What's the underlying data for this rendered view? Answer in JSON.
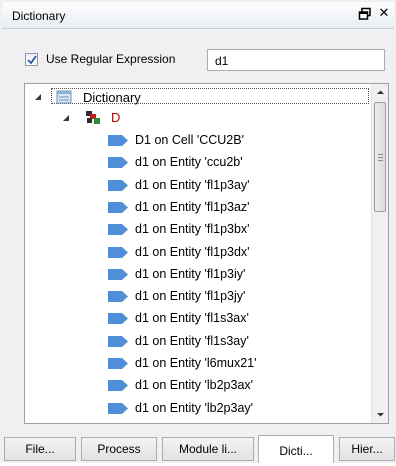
{
  "panel": {
    "title": "Dictionary"
  },
  "regex": {
    "label": "Use Regular Expression",
    "checked": true,
    "value": "d1"
  },
  "tree": {
    "root_label": "Dictionary",
    "group_label": "D",
    "items": [
      "D1 on Cell 'CCU2B'",
      "d1 on Entity 'ccu2b'",
      "d1 on Entity 'fl1p3ay'",
      "d1 on Entity 'fl1p3az'",
      "d1 on Entity 'fl1p3bx'",
      "d1 on Entity 'fl1p3dx'",
      "d1 on Entity 'fl1p3iy'",
      "d1 on Entity 'fl1p3jy'",
      "d1 on Entity 'fl1s3ax'",
      "d1 on Entity 'fl1s3ay'",
      "d1 on Entity 'l6mux21'",
      "d1 on Entity 'lb2p3ax'",
      "d1 on Entity 'lb2p3ay'"
    ]
  },
  "tabs": [
    "File...",
    "Process",
    "Module li...",
    "Dicti...",
    "Hier..."
  ],
  "active_tab": 3,
  "icons": {
    "float": "float-window-icon",
    "close": "close-icon",
    "root": "database-icon",
    "group": "component-group-icon",
    "leaf": "tag-arrow-icon"
  },
  "colors": {
    "group_label": "#c00000",
    "leaf_icon": "#4f8fd9",
    "check": "#2a5a9e"
  }
}
